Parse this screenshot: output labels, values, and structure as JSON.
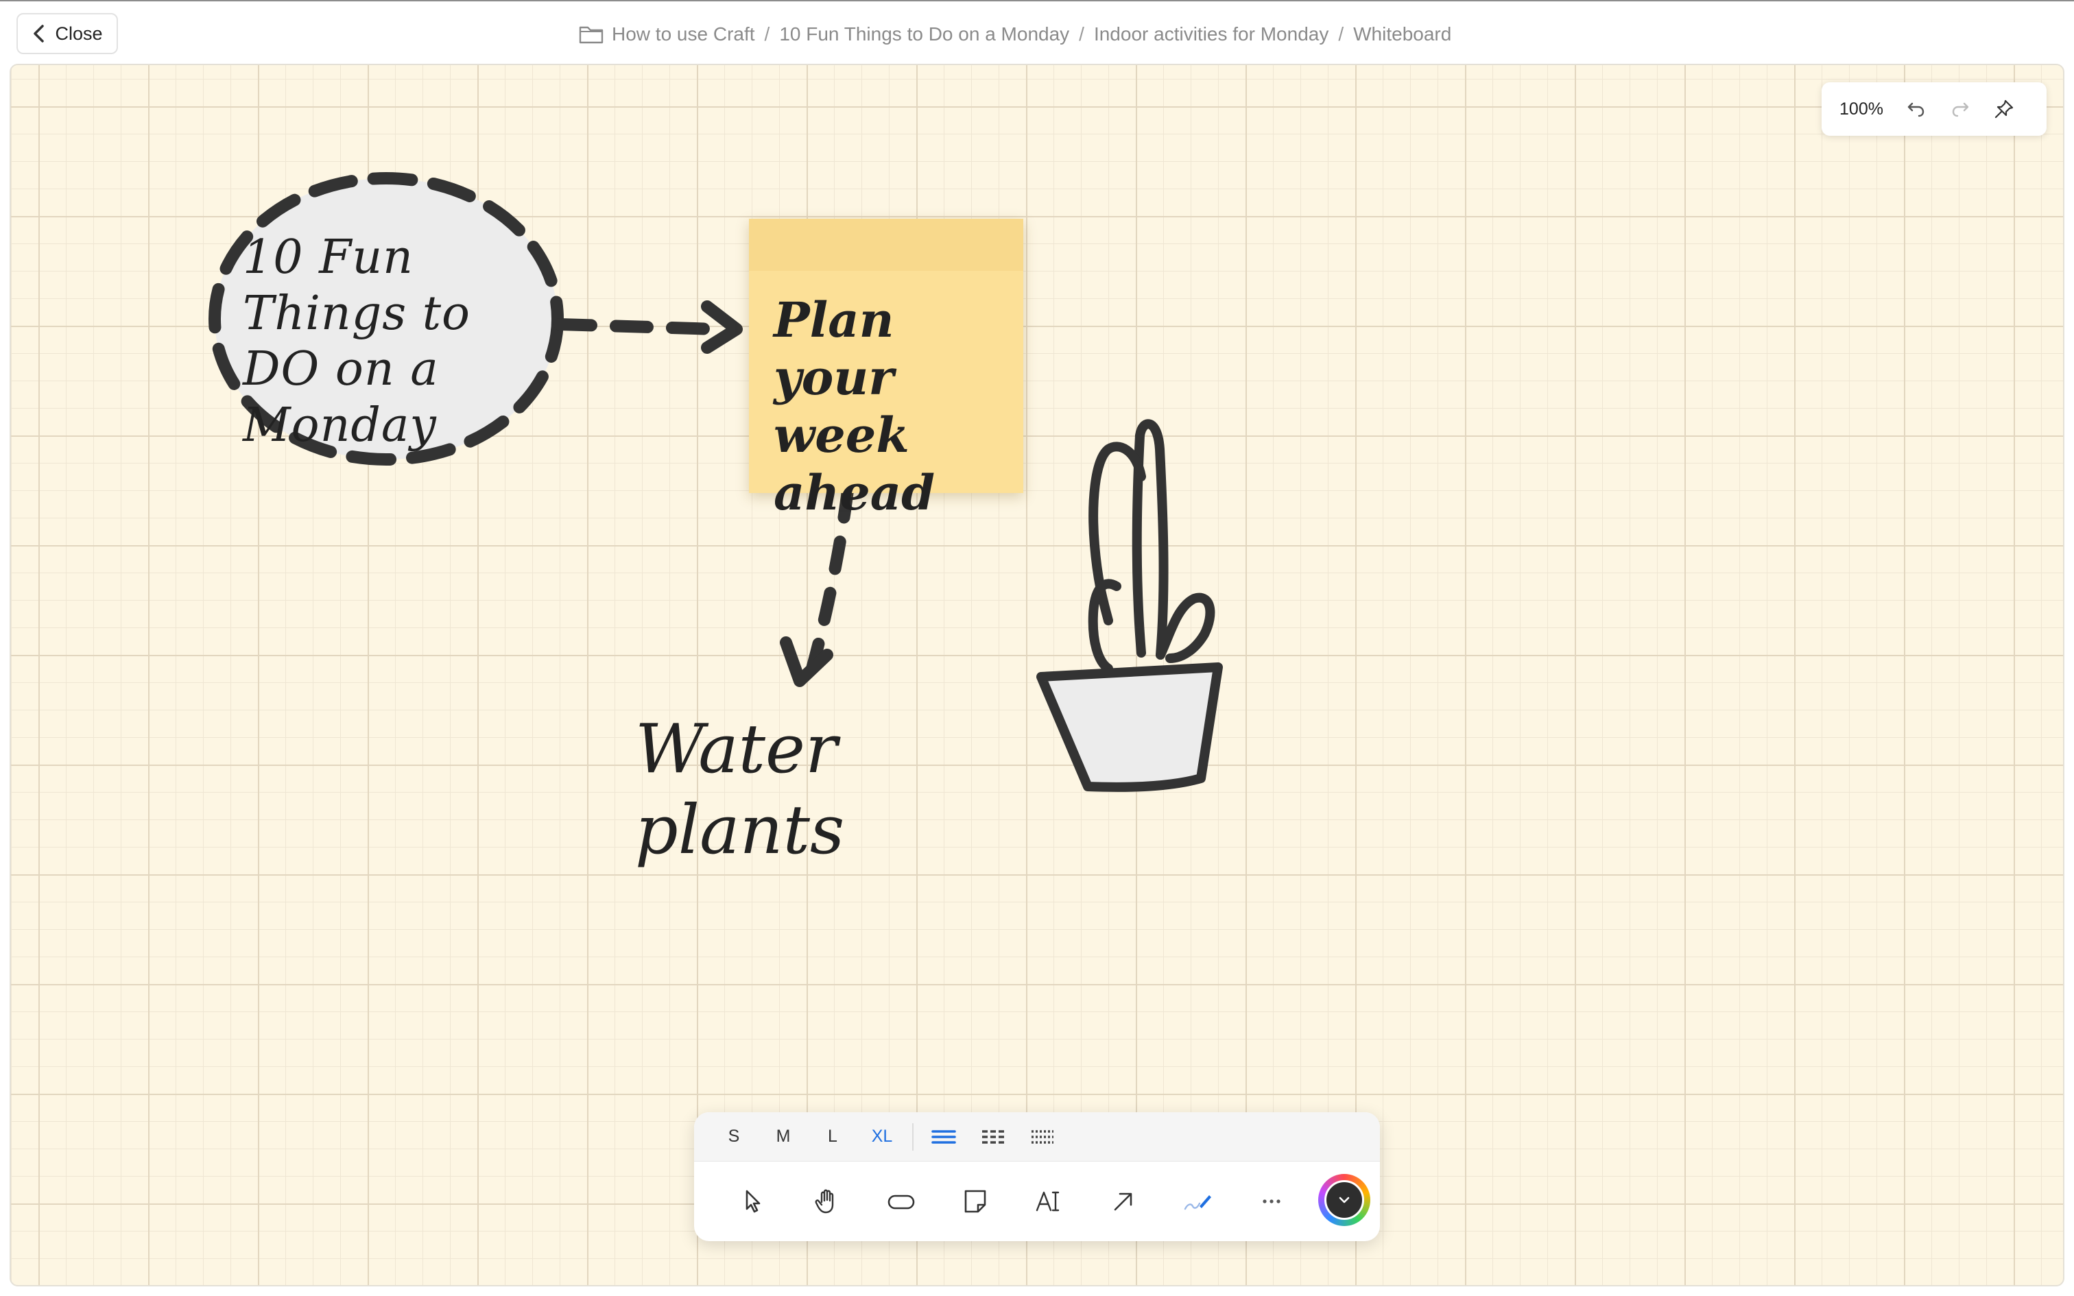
{
  "header": {
    "close_label": "Close",
    "breadcrumb": [
      "How to use Craft",
      "10 Fun Things to Do on a Monday",
      "Indoor activities for Monday",
      "Whiteboard"
    ],
    "separator": "/"
  },
  "canvas": {
    "oval_text": "10 Fun Things to DO on a Monday",
    "sticky_text": "Plan your week ahead",
    "water_text": "Water plants",
    "sticky_color": "#fce097",
    "stroke_color": "#333333"
  },
  "viewbar": {
    "zoom": "100%",
    "icons": [
      "undo-icon",
      "redo-icon",
      "pin-icon"
    ]
  },
  "toolbar": {
    "sizes": [
      "S",
      "M",
      "L",
      "XL"
    ],
    "active_size": "XL",
    "stroke_styles": [
      "solid-line-icon",
      "dashed-line-icon",
      "dotted-line-icon"
    ],
    "tools": [
      "select-pointer-icon",
      "hand-pan-icon",
      "shape-oval-icon",
      "sticky-note-icon",
      "text-tool-icon",
      "arrow-tool-icon",
      "pen-tool-icon",
      "more-icon"
    ],
    "accent_color": "#1f6fe0"
  }
}
